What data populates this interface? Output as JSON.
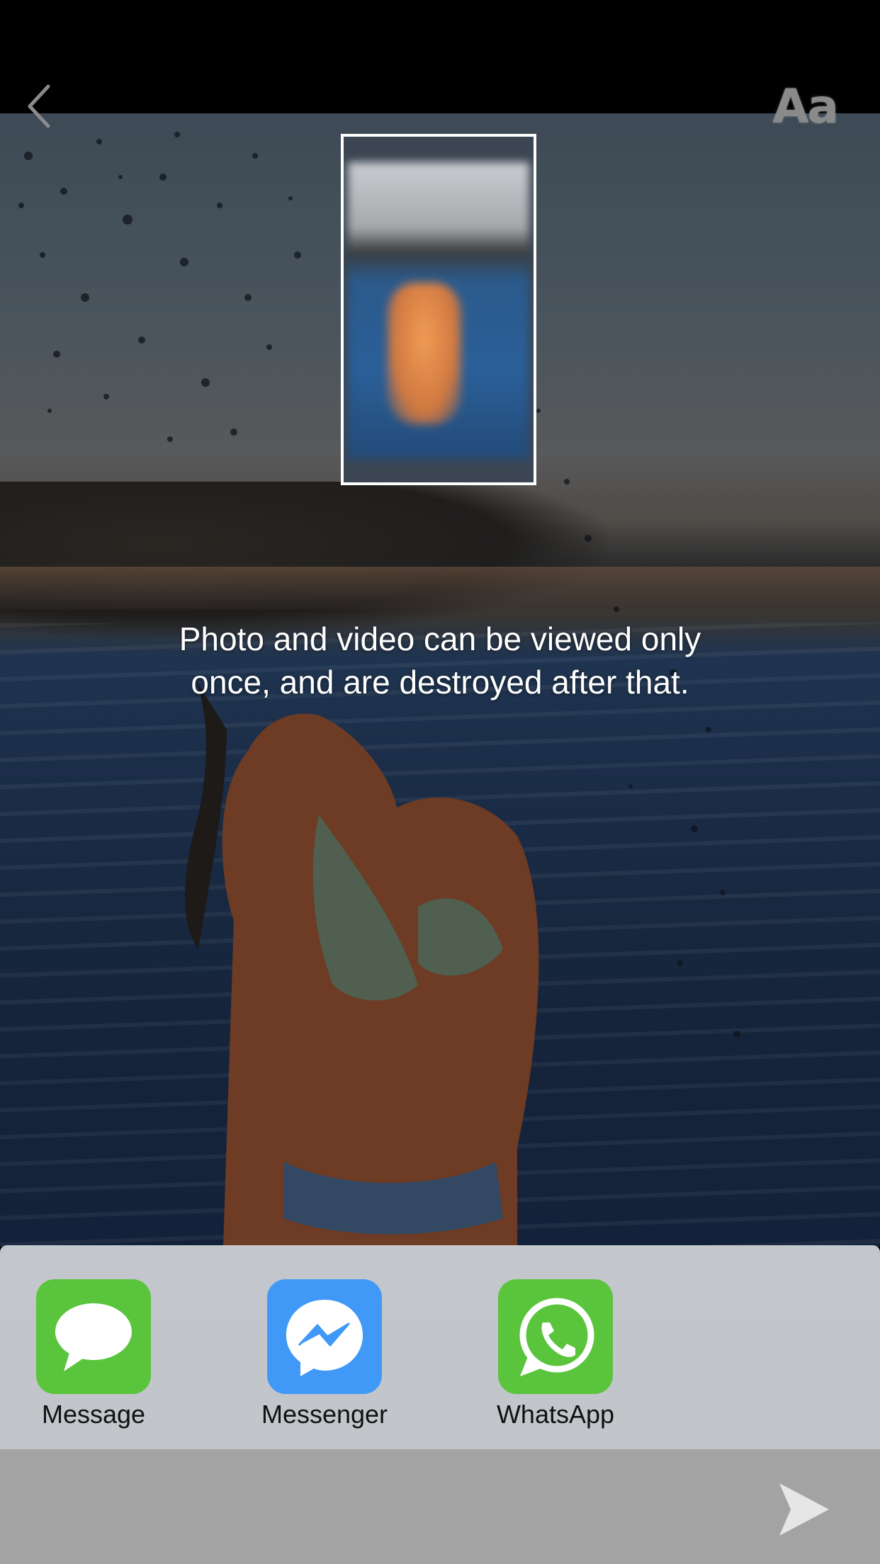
{
  "header": {
    "back_icon": "chevron-left-icon",
    "font_button_label": "Aa"
  },
  "notice": {
    "text": "Photo and video can be viewed only once, and are destroyed after that."
  },
  "share": {
    "apps": [
      {
        "label": "Message",
        "icon": "message-bubble-icon",
        "color": "#5ac43c"
      },
      {
        "label": "Messenger",
        "icon": "messenger-icon",
        "color": "#4099f7"
      },
      {
        "label": "WhatsApp",
        "icon": "whatsapp-icon",
        "color": "#5ac43c"
      }
    ]
  },
  "footer": {
    "send_icon": "send-icon"
  },
  "colors": {
    "overlay_white": "#ffffff",
    "bottom_bar": "#a3a3a3"
  }
}
